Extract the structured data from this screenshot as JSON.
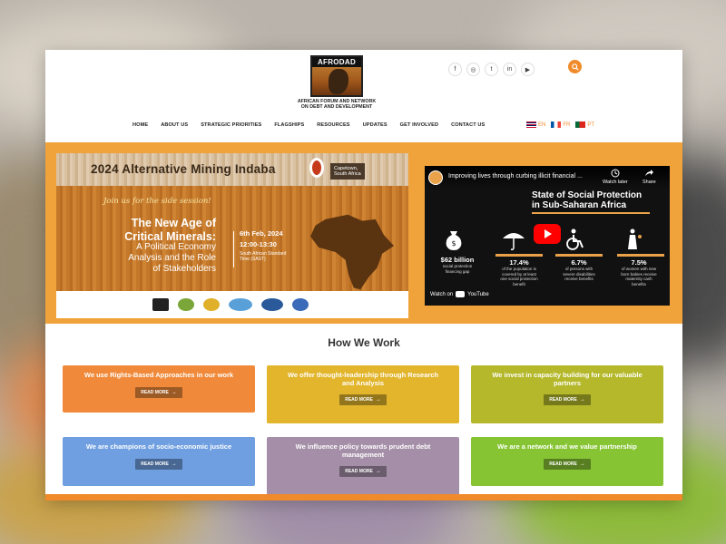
{
  "logo": {
    "mark_text": "AFRODAD",
    "subtitle_line1": "AFRICAN FORUM AND NETWORK",
    "subtitle_line2": "ON DEBT AND DEVELOPMENT"
  },
  "social": [
    "facebook-icon",
    "instagram-icon",
    "twitter-icon",
    "linkedin-icon",
    "youtube-icon"
  ],
  "social_glyphs": {
    "facebook": "f",
    "instagram": "◎",
    "twitter": "t",
    "linkedin": "in",
    "youtube": "▶"
  },
  "nav": {
    "items": [
      "HOME",
      "ABOUT US",
      "STRATEGIC PRIORITIES",
      "FLAGSHIPS",
      "RESOURCES",
      "UPDATES",
      "GET INVOLVED",
      "CONTACT US"
    ]
  },
  "languages": [
    {
      "code": "EN",
      "flag": "en"
    },
    {
      "code": "FR",
      "flag": "fr"
    },
    {
      "code": "PT",
      "flag": "pt"
    }
  ],
  "poster": {
    "title": "2024 Alternative Mining Indaba",
    "location_line1": "Capetown,",
    "location_line2": "South Africa",
    "join": "Join us for the side session!",
    "heading_line1": "The New Age of",
    "heading_line2": "Critical Minerals:",
    "sub_line1": "A Political Economy",
    "sub_line2": "Analysis and the Role",
    "sub_line3": "of Stakeholders",
    "date": "6th Feb, 2024",
    "time": "12:00-13:30",
    "zone_line1": "South African Standard",
    "zone_line2": "Time (SAST)"
  },
  "video": {
    "title": "Improving lives through curbing illicit financial ...",
    "watch_later": "Watch later",
    "share": "Share",
    "heading_line1": "State of Social Protection",
    "heading_line2": "in Sub-Saharan Africa",
    "stats": [
      {
        "value": "$62 billion",
        "label_line1": "social protection",
        "label_line2": "financing gap"
      },
      {
        "value": "17.4%",
        "label_line1": "of the population is",
        "label_line2": "covered by at least",
        "label_line3": "one social protection",
        "label_line4": "benefit"
      },
      {
        "value": "6.7%",
        "label_line1": "of persons with",
        "label_line2": "severe disabilities",
        "label_line3": "receive benefits"
      },
      {
        "value": "7.5%",
        "label_line1": "of women with new",
        "label_line2": "born babies receive",
        "label_line3": "maternity cash",
        "label_line4": "benefits"
      }
    ],
    "watch_on": "Watch on",
    "youtube": "YouTube"
  },
  "how": {
    "title": "How We Work",
    "read_more": "READ MORE",
    "cards": [
      {
        "text": "We use Rights-Based Approaches in our work",
        "color": "#f08a3a"
      },
      {
        "text": "We offer thought-leadership through Research and Analysis",
        "color": "#e2b52c"
      },
      {
        "text": "We invest in capacity building for our valuable partners",
        "color": "#b4b82a"
      },
      {
        "text": "We are champions of socio-economic justice",
        "color": "#6f9fe0"
      },
      {
        "text": "We influence policy towards prudent debt management",
        "color": "#a58ea8"
      },
      {
        "text": "We are a network and we value partnership",
        "color": "#86c434"
      }
    ]
  }
}
